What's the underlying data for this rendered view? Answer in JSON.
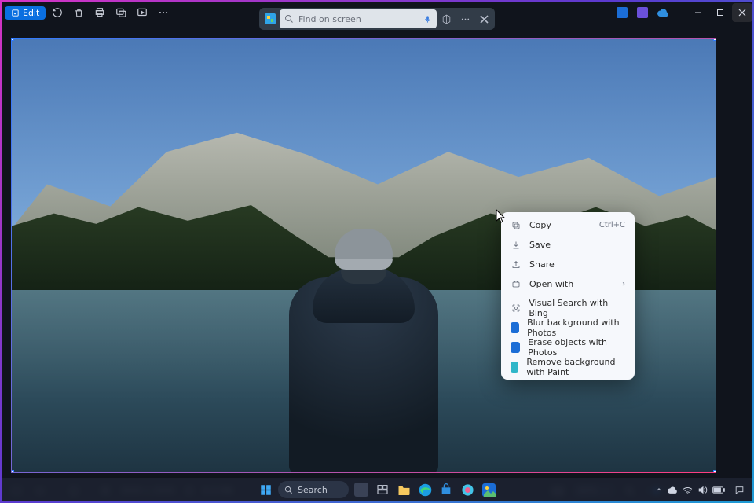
{
  "titlebar": {
    "edit_label": "Edit"
  },
  "search": {
    "placeholder": "Find on screen"
  },
  "context_menu": {
    "copy": "Copy",
    "copy_kb": "Ctrl+C",
    "save": "Save",
    "share": "Share",
    "open_with": "Open with",
    "visual_search": "Visual Search with Bing",
    "blur_bg": "Blur background with Photos",
    "erase": "Erase objects with Photos",
    "remove_bg": "Remove background with Paint"
  },
  "status": {
    "dimensions": "3000 x 2000",
    "filesize": "6.9 MB",
    "zoom": "62%"
  },
  "taskbar": {
    "search": "Search"
  },
  "tray": {
    "time": "",
    "date": ""
  }
}
